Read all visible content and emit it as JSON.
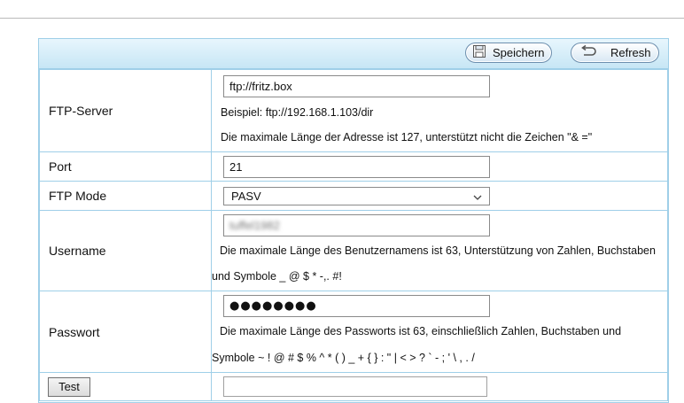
{
  "toolbar": {
    "save_label": "Speichern",
    "refresh_label": "Refresh"
  },
  "ftp_server": {
    "label": "FTP-Server",
    "value": "ftp://fritz.box",
    "example": "Beispiel: ftp://192.168.1.103/dir",
    "hint": "Die maximale Länge der Adresse ist 127, unterstützt nicht die Zeichen \"& =\""
  },
  "port": {
    "label": "Port",
    "value": "21"
  },
  "ftp_mode": {
    "label": "FTP Mode",
    "value": "PASV"
  },
  "username": {
    "label": "Username",
    "value": "tuffel1982",
    "hint_line1": "Die maximale Länge des Benutzernamens ist 63, Unterstützung von Zahlen, Buchstaben",
    "hint_line2": "und Symbole _ @ $ * -,. #!"
  },
  "password": {
    "label": "Passwort",
    "value": "●●●●●●●●",
    "hint_line1": "Die maximale Länge des Passworts ist 63, einschließlich Zahlen, Buchstaben und",
    "hint_line2": "Symbole ~ ! @ # $ % ^ * ( ) _ + { } : \" | < > ? ` - ; ' \\ , . /"
  },
  "test": {
    "label": "Test",
    "result": ""
  }
}
